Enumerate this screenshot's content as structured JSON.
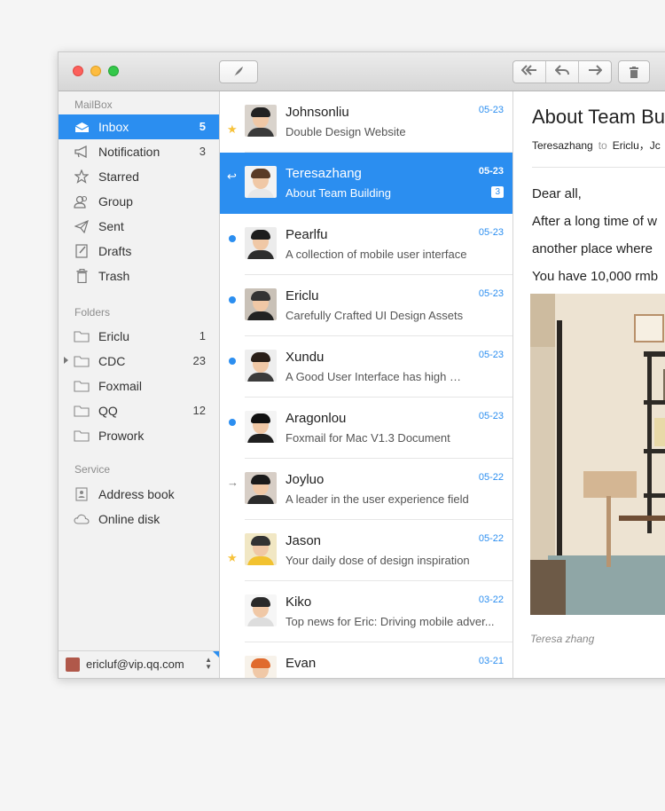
{
  "toolbar": {
    "compose_icon": "feather-compose-icon",
    "reply_all_icon": "reply-all-icon",
    "reply_icon": "reply-icon",
    "forward_icon": "forward-icon",
    "delete_icon": "trash-icon"
  },
  "sidebar": {
    "mailbox_title": "MailBox",
    "mailbox_items": [
      {
        "label": "Inbox",
        "count": "5",
        "icon": "inbox-icon",
        "active": true
      },
      {
        "label": "Notification",
        "count": "3",
        "icon": "megaphone-icon"
      },
      {
        "label": "Starred",
        "count": "",
        "icon": "star-icon"
      },
      {
        "label": "Group",
        "count": "",
        "icon": "group-icon"
      },
      {
        "label": "Sent",
        "count": "",
        "icon": "paper-plane-icon"
      },
      {
        "label": "Drafts",
        "count": "",
        "icon": "draft-icon"
      },
      {
        "label": "Trash",
        "count": "",
        "icon": "trash-icon"
      }
    ],
    "folders_title": "Folders",
    "folder_items": [
      {
        "label": "Ericlu",
        "count": "1",
        "icon": "folder-icon"
      },
      {
        "label": "CDC",
        "count": "23",
        "icon": "folder-icon",
        "expandable": true
      },
      {
        "label": "Foxmail",
        "count": "",
        "icon": "folder-icon"
      },
      {
        "label": "QQ",
        "count": "12",
        "icon": "folder-icon"
      },
      {
        "label": "Prowork",
        "count": "",
        "icon": "folder-icon"
      }
    ],
    "service_title": "Service",
    "service_items": [
      {
        "label": "Address book",
        "icon": "address-book-icon"
      },
      {
        "label": "Online disk",
        "icon": "cloud-icon"
      }
    ],
    "account": "ericluf@vip.qq.com"
  },
  "messages": [
    {
      "name": "Johnsonliu",
      "subject": "Double Design Website",
      "date": "05-23",
      "flag": "star"
    },
    {
      "name": "Teresazhang",
      "subject": "About Team Building",
      "date": "05-23",
      "flag": "replied",
      "badge": "3",
      "selected": true
    },
    {
      "name": "Pearlfu",
      "subject": "A collection of mobile user interface",
      "date": "05-23",
      "flag": "unread"
    },
    {
      "name": "Ericlu",
      "subject": "Carefully Crafted UI Design Assets",
      "date": "05-23",
      "flag": "unread"
    },
    {
      "name": "Xundu",
      "subject": "A Good User Interface has high …",
      "date": "05-23",
      "flag": "unread"
    },
    {
      "name": "Aragonlou",
      "subject": "Foxmail for Mac  V1.3 Document",
      "date": "05-23",
      "flag": "unread"
    },
    {
      "name": "Joyluo",
      "subject": "A leader in the user experience field",
      "date": "05-22",
      "flag": "forwarded"
    },
    {
      "name": "Jason",
      "subject": "Your daily dose of design inspiration",
      "date": "05-22",
      "flag": "star"
    },
    {
      "name": "Kiko",
      "subject": "Top news for Eric: Driving mobile adver...",
      "date": "03-22",
      "flag": ""
    },
    {
      "name": "Evan",
      "subject": "",
      "date": "03-21",
      "flag": ""
    }
  ],
  "reader": {
    "title": "About Team Bu",
    "from": "Teresazhang",
    "to_label": "to",
    "recipients": "Ericlu，Jc",
    "body_lines": [
      "Dear all,",
      "After a long time of w",
      "another place where",
      "You have 10,000 rmb"
    ],
    "caption": "Teresa zhang"
  },
  "colors": {
    "accent": "#2b8ef0",
    "star": "#f7c23a"
  }
}
